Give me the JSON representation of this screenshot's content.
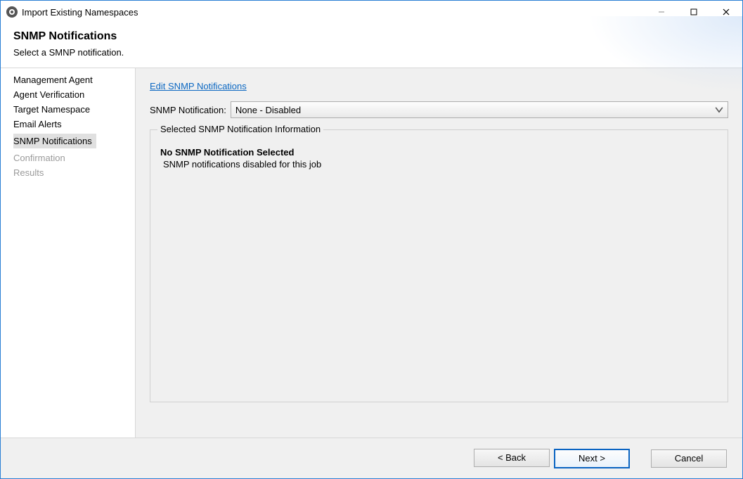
{
  "window": {
    "title": "Import Existing Namespaces"
  },
  "header": {
    "title": "SNMP Notifications",
    "subtitle": "Select a SMNP notification."
  },
  "sidebar": {
    "items": [
      {
        "label": "Management Agent",
        "state": "normal"
      },
      {
        "label": "Agent Verification",
        "state": "normal"
      },
      {
        "label": "Target Namespace",
        "state": "normal"
      },
      {
        "label": "Email Alerts",
        "state": "normal"
      },
      {
        "label": "SNMP Notifications",
        "state": "selected"
      },
      {
        "label": "Confirmation",
        "state": "disabled"
      },
      {
        "label": "Results",
        "state": "disabled"
      }
    ]
  },
  "content": {
    "edit_link": "Edit SNMP Notifications",
    "dropdown_label": "SNMP Notification:",
    "dropdown_value": "None - Disabled",
    "group_legend": "Selected SNMP Notification Information",
    "notice_title": "No SNMP Notification Selected",
    "notice_body": "SNMP notifications disabled for this job"
  },
  "footer": {
    "back": "< Back",
    "next": "Next >",
    "cancel": "Cancel"
  }
}
